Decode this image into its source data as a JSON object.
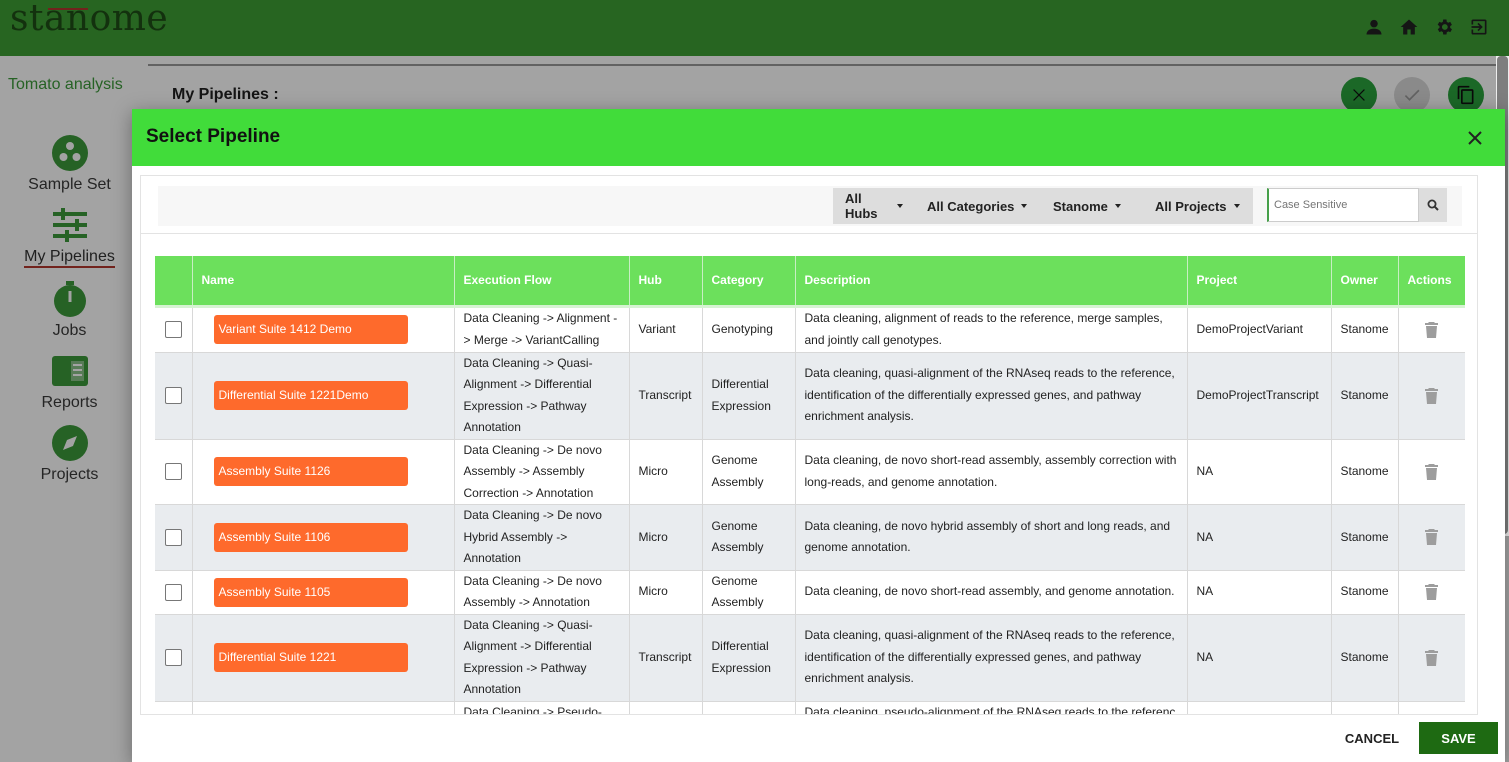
{
  "app": {
    "logo": "stanome",
    "project_name": "Tomato analysis"
  },
  "sidebar": {
    "items": [
      {
        "label": "Sample Set",
        "icon": "sample-set-icon"
      },
      {
        "label": "My Pipelines",
        "icon": "sliders-icon",
        "active": true
      },
      {
        "label": "Jobs",
        "icon": "stopwatch-icon"
      },
      {
        "label": "Reports",
        "icon": "report-icon"
      },
      {
        "label": "Projects",
        "icon": "compass-icon"
      }
    ]
  },
  "main": {
    "title": "My Pipelines :"
  },
  "dialog": {
    "title": "Select Pipeline",
    "filters": {
      "hubs": "All Hubs",
      "categories": "All Categories",
      "owner": "Stanome",
      "projects": "All Projects",
      "search_placeholder": "Case Sensitive"
    },
    "table": {
      "headers": [
        "Name",
        "Execution Flow",
        "Hub",
        "Category",
        "Description",
        "Project",
        "Owner",
        "Actions"
      ],
      "rows": [
        {
          "name": "Variant Suite 1412 Demo",
          "flow": "Data Cleaning -> Alignment -> Merge -> VariantCalling",
          "hub": "Variant",
          "category": "Genotyping",
          "description": "Data cleaning, alignment of reads to the reference, merge samples, and jointly call genotypes.",
          "project": "DemoProjectVariant",
          "owner": "Stanome"
        },
        {
          "name": "Differential Suite 1221Demo",
          "flow": "Data Cleaning -> Quasi-Alignment -> Differential Expression -> Pathway Annotation",
          "hub": "Transcript",
          "category": "Differential Expression",
          "description": "Data cleaning, quasi-alignment of the RNAseq reads to the reference, identification of the differentially expressed genes, and pathway enrichment analysis.",
          "project": "DemoProjectTranscript",
          "owner": "Stanome"
        },
        {
          "name": "Assembly Suite 1126",
          "flow": "Data Cleaning -> De novo Assembly -> Assembly Correction -> Annotation",
          "hub": "Micro",
          "category": "Genome Assembly",
          "description": "Data cleaning, de novo short-read assembly, assembly correction with long-reads, and genome annotation.",
          "project": "NA",
          "owner": "Stanome"
        },
        {
          "name": "Assembly Suite 1106",
          "flow": "Data Cleaning -> De novo Hybrid Assembly -> Annotation",
          "hub": "Micro",
          "category": "Genome Assembly",
          "description": "Data cleaning, de novo hybrid assembly of short and long reads, and genome annotation.",
          "project": "NA",
          "owner": "Stanome"
        },
        {
          "name": "Assembly Suite 1105",
          "flow": "Data Cleaning -> De novo Assembly -> Annotation",
          "hub": "Micro",
          "category": "Genome Assembly",
          "description": "Data cleaning, de novo short-read assembly, and genome annotation.",
          "project": "NA",
          "owner": "Stanome"
        },
        {
          "name": "Differential Suite 1221",
          "flow": "Data Cleaning -> Quasi-Alignment -> Differential Expression -> Pathway Annotation",
          "hub": "Transcript",
          "category": "Differential Expression",
          "description": "Data cleaning, quasi-alignment of the RNAseq reads to the reference, identification of the differentially expressed genes, and pathway enrichment analysis.",
          "project": "NA",
          "owner": "Stanome"
        },
        {
          "name": "",
          "flow": "Data Cleaning -> Pseudo-",
          "hub": "",
          "category": "",
          "description": "Data cleaning, pseudo-alignment of the RNAseq reads to the referenc",
          "project": "",
          "owner": ""
        }
      ]
    },
    "cancel_label": "CANCEL",
    "save_label": "SAVE"
  },
  "colors": {
    "topbar": "#3e9e35",
    "dialog_header": "#41dc3a",
    "table_header": "#6ce05c",
    "name_button": "#fe6a2c",
    "save_button": "#1e6a12",
    "sidebar_accent": "#3c9a3a"
  }
}
